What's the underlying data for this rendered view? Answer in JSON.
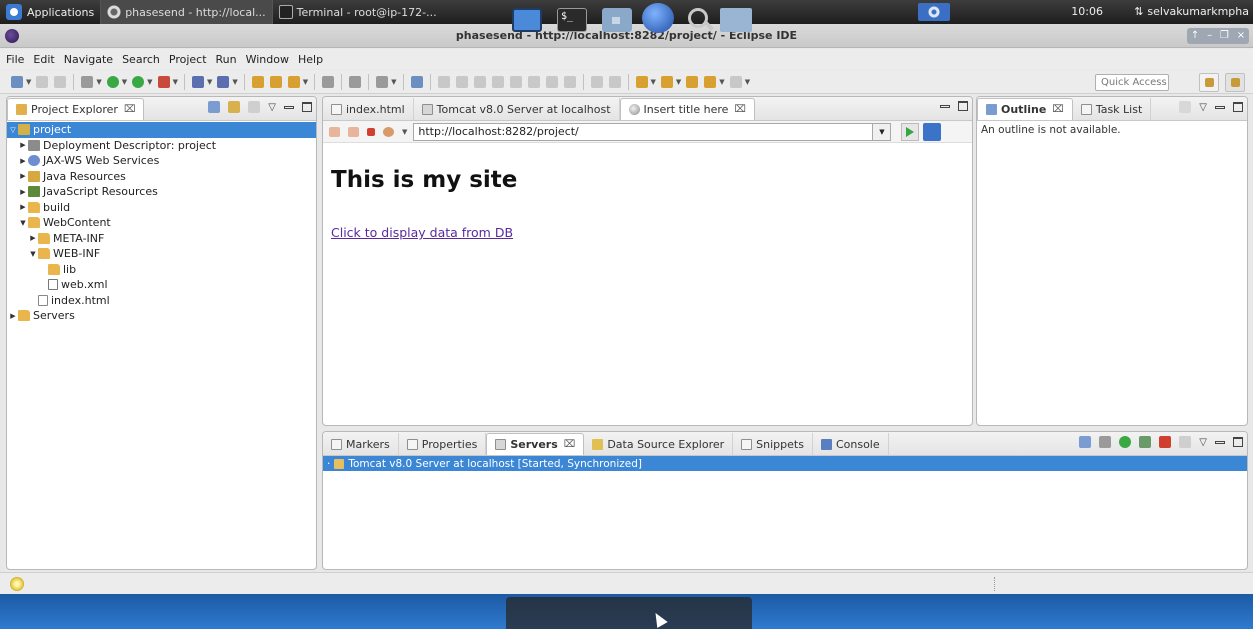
{
  "os_panel": {
    "applications_label": "Applications",
    "tasks": [
      {
        "label": "phasesend - http://local...",
        "active": true
      },
      {
        "label": "Terminal - root@ip-172-...",
        "active": false
      }
    ],
    "clock": "10:06",
    "user": "selvakumarkmpha"
  },
  "window": {
    "title": "phasesend - http://localhost:8282/project/ - Eclipse IDE",
    "controls": [
      "↑",
      "–",
      "❐",
      "×"
    ]
  },
  "menu": [
    "File",
    "Edit",
    "Navigate",
    "Search",
    "Project",
    "Run",
    "Window",
    "Help"
  ],
  "toolbar": {
    "quick_access_placeholder": "Quick Access"
  },
  "project_explorer": {
    "tab_label": "Project Explorer",
    "tab_close": "⌧",
    "tree": [
      {
        "label": "project",
        "depth": 0,
        "twisty": "▽",
        "icon": "proj",
        "selected": true
      },
      {
        "label": "Deployment Descriptor: project",
        "depth": 1,
        "twisty": "▶",
        "icon": "dd"
      },
      {
        "label": "JAX-WS Web Services",
        "depth": 1,
        "twisty": "▶",
        "icon": "ws"
      },
      {
        "label": "Java Resources",
        "depth": 1,
        "twisty": "▶",
        "icon": "jr"
      },
      {
        "label": "JavaScript Resources",
        "depth": 1,
        "twisty": "▶",
        "icon": "js"
      },
      {
        "label": "build",
        "depth": 1,
        "twisty": "▶",
        "icon": "folder"
      },
      {
        "label": "WebContent",
        "depth": 1,
        "twisty": "▼",
        "icon": "folder"
      },
      {
        "label": "META-INF",
        "depth": 2,
        "twisty": "▶",
        "icon": "folder"
      },
      {
        "label": "WEB-INF",
        "depth": 2,
        "twisty": "▼",
        "icon": "folder"
      },
      {
        "label": "lib",
        "depth": 3,
        "twisty": "",
        "icon": "folder"
      },
      {
        "label": "web.xml",
        "depth": 3,
        "twisty": "",
        "icon": "xml"
      },
      {
        "label": "index.html",
        "depth": 2,
        "twisty": "",
        "icon": "file"
      },
      {
        "label": "Servers",
        "depth": 0,
        "twisty": "▶",
        "icon": "folder"
      }
    ]
  },
  "editor": {
    "tabs": [
      {
        "label": "index.html",
        "icon": "file",
        "active": false
      },
      {
        "label": "Tomcat v8.0 Server at localhost",
        "icon": "server",
        "active": false
      },
      {
        "label": "Insert title here",
        "icon": "globe",
        "active": true,
        "close": "⌧"
      }
    ],
    "url": "http://localhost:8282/project/",
    "page_heading": "This is my site",
    "page_link": "Click to display data from DB"
  },
  "outline": {
    "tabs": [
      {
        "label": "Outline",
        "active": true,
        "close": "⌧"
      },
      {
        "label": "Task List",
        "active": false
      }
    ],
    "message": "An outline is not available."
  },
  "bottom_panel": {
    "tabs": [
      {
        "label": "Markers",
        "active": false
      },
      {
        "label": "Properties",
        "active": false
      },
      {
        "label": "Servers",
        "active": true,
        "close": "⌧"
      },
      {
        "label": "Data Source Explorer",
        "active": false
      },
      {
        "label": "Snippets",
        "active": false
      },
      {
        "label": "Console",
        "active": false
      }
    ],
    "server_row": "Tomcat v8.0 Server at localhost  [Started, Synchronized]"
  },
  "dock": {
    "terminal_glyph": "$_"
  }
}
